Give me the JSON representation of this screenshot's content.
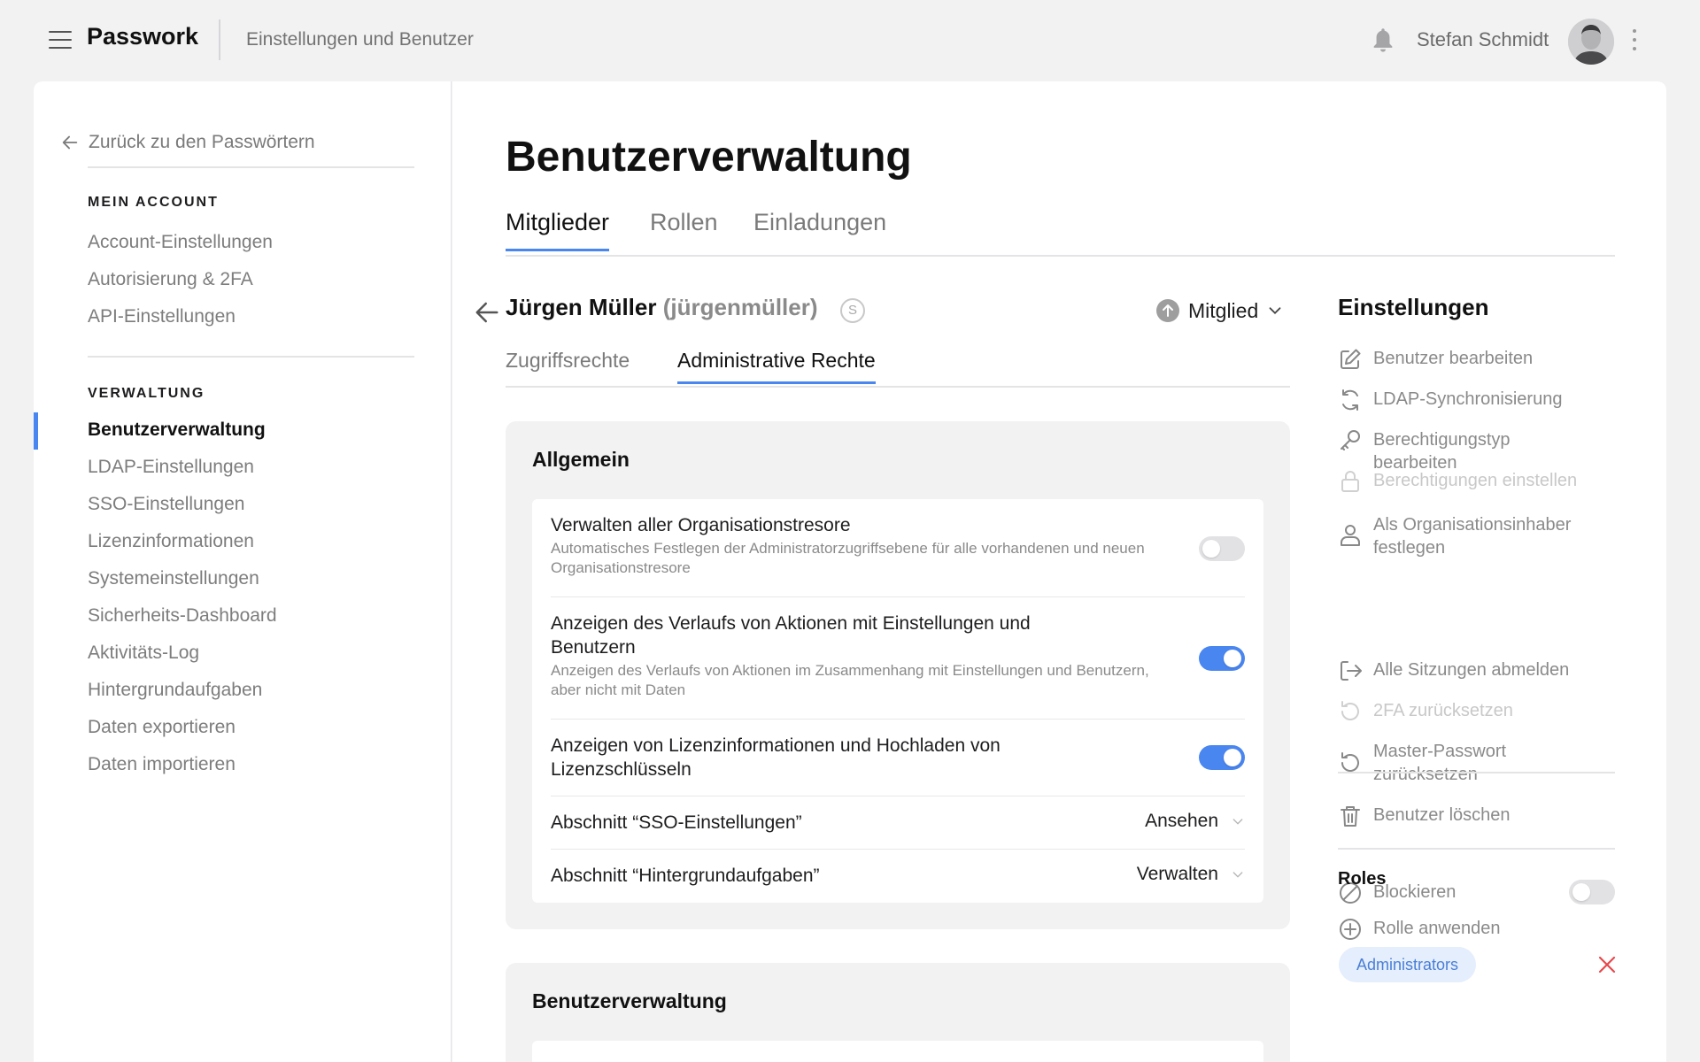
{
  "app": {
    "brand": "Passwork",
    "breadcrumb": "Einstellungen und Benutzer",
    "user_name": "Stefan Schmidt"
  },
  "sidebar": {
    "back_label": "Zurück zu den Passwörtern",
    "sections": [
      {
        "heading": "MEIN ACCOUNT",
        "items": [
          "Account-Einstellungen",
          "Autorisierung & 2FA",
          "API-Einstellungen"
        ]
      },
      {
        "heading": "VERWALTUNG",
        "items": [
          "Benutzerverwaltung",
          "LDAP-Einstellungen",
          "SSO-Einstellungen",
          "Lizenzinformationen",
          "Systemeinstellungen",
          "Sicherheits-Dashboard",
          "Aktivitäts-Log",
          "Hintergrundaufgaben",
          "Daten exportieren",
          "Daten importieren"
        ]
      }
    ],
    "active_item": "Benutzerverwaltung"
  },
  "main": {
    "title": "Benutzerverwaltung",
    "tabs": [
      "Mitglieder",
      "Rollen",
      "Einladungen"
    ],
    "active_tab": "Mitglieder",
    "user": {
      "name": "Jürgen Müller",
      "login": "(jürgenmüller)",
      "badge": "S",
      "role": "Mitglied"
    },
    "subtabs": [
      "Zugriffsrechte",
      "Administrative Rechte"
    ],
    "active_subtab": "Administrative Rechte",
    "sections": [
      {
        "title": "Allgemein",
        "rows": [
          {
            "title": "Verwalten aller Organisationstresore",
            "desc": "Automatisches Festlegen der Administratorzugriffsebene für alle vorhandenen und neuen Organisationstresore",
            "control": "toggle",
            "value": false
          },
          {
            "title": "Anzeigen des Verlaufs von Aktionen mit Einstellungen und Benutzern",
            "desc": "Anzeigen des Verlaufs von Aktionen im Zusammenhang mit Einstellungen und Benutzern, aber nicht mit Daten",
            "control": "toggle",
            "value": true
          },
          {
            "title": "Anzeigen von Lizenzinformationen und Hochladen von Lizenzschlüsseln",
            "desc": "",
            "control": "toggle",
            "value": true
          },
          {
            "title": "Abschnitt “SSO-Einstellungen”",
            "desc": "",
            "control": "dropdown",
            "value": "Ansehen"
          },
          {
            "title": "Abschnitt “Hintergrundaufgaben”",
            "desc": "",
            "control": "dropdown",
            "value": "Verwalten"
          }
        ]
      },
      {
        "title": "Benutzerverwaltung",
        "rows": []
      }
    ]
  },
  "settings": {
    "title": "Einstellungen",
    "items": [
      {
        "label": "Benutzer bearbeiten",
        "icon": "edit-icon",
        "disabled": false
      },
      {
        "label": "LDAP-Synchronisierung",
        "icon": "sync-icon",
        "disabled": false
      },
      {
        "label": "Berechtigungstyp bearbeiten",
        "icon": "key-icon",
        "disabled": false
      },
      {
        "label": "Berechtigungen einstellen",
        "icon": "lock-icon",
        "disabled": true
      },
      {
        "label": "Als Organisationsinhaber festlegen",
        "icon": "user-icon",
        "disabled": false
      },
      {
        "label": "Alle Sitzungen abmelden",
        "icon": "logout-icon",
        "disabled": false
      },
      {
        "label": "2FA zurücksetzen",
        "icon": "reset-icon",
        "disabled": true
      },
      {
        "label": "Master-Passwort zurücksetzen",
        "icon": "reset-icon",
        "disabled": false
      },
      {
        "label": "Benutzer löschen",
        "icon": "trash-icon",
        "disabled": false
      }
    ],
    "block_label": "Blockieren",
    "block_value": false,
    "roles_title": "Roles",
    "apply_role_label": "Rolle anwenden",
    "roles": [
      "Administrators"
    ]
  },
  "colors": {
    "accent": "#4a86f0",
    "background": "#f2f2f3",
    "chip_bg": "#e5eefc",
    "danger": "#e5484d"
  }
}
